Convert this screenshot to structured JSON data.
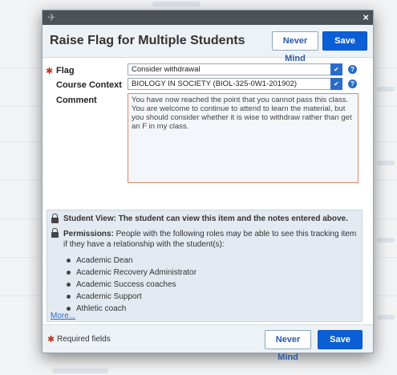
{
  "dialog": {
    "title": "Raise Flag for Multiple Students",
    "never_mind_label": "Never Mind",
    "save_label": "Save",
    "close_glyph": "×",
    "pin_glyph": "✈"
  },
  "form": {
    "required_glyph": "✱",
    "flag": {
      "label": "Flag",
      "value": "Consider withdrawal",
      "required": true
    },
    "course_context": {
      "label": "Course Context",
      "value": "BIOLOGY IN SOCIETY (BIOL-325-0W1-201902)"
    },
    "comment": {
      "label": "Comment",
      "value": "You have now reached the point that you cannot pass this class.  You are welcome to continue to attend to learn the material, but you should consider whether it is wise to withdraw rather than get an F in my class."
    },
    "dropdown_arrow": "✔",
    "help_glyph": "?"
  },
  "info": {
    "student_view": "Student View: The student can view this item and the notes entered above.",
    "permissions_label": "Permissions:",
    "permissions_text": " People with the following roles may be able to see this tracking item if they have a relationship with the student(s):",
    "roles": [
      "Academic Dean",
      "Academic Recovery Administrator",
      "Academic Success coaches",
      "Academic Support",
      "Athletic coach"
    ],
    "more_link": "More..."
  },
  "footer": {
    "required_note": "Required fields",
    "never_mind_label": "Never Mind",
    "save_label": "Save"
  },
  "colors": {
    "primary_button": "#0a5fd7",
    "title_bar": "#4a5258",
    "required": "#c4321a",
    "comment_border": "#e08a5d"
  }
}
